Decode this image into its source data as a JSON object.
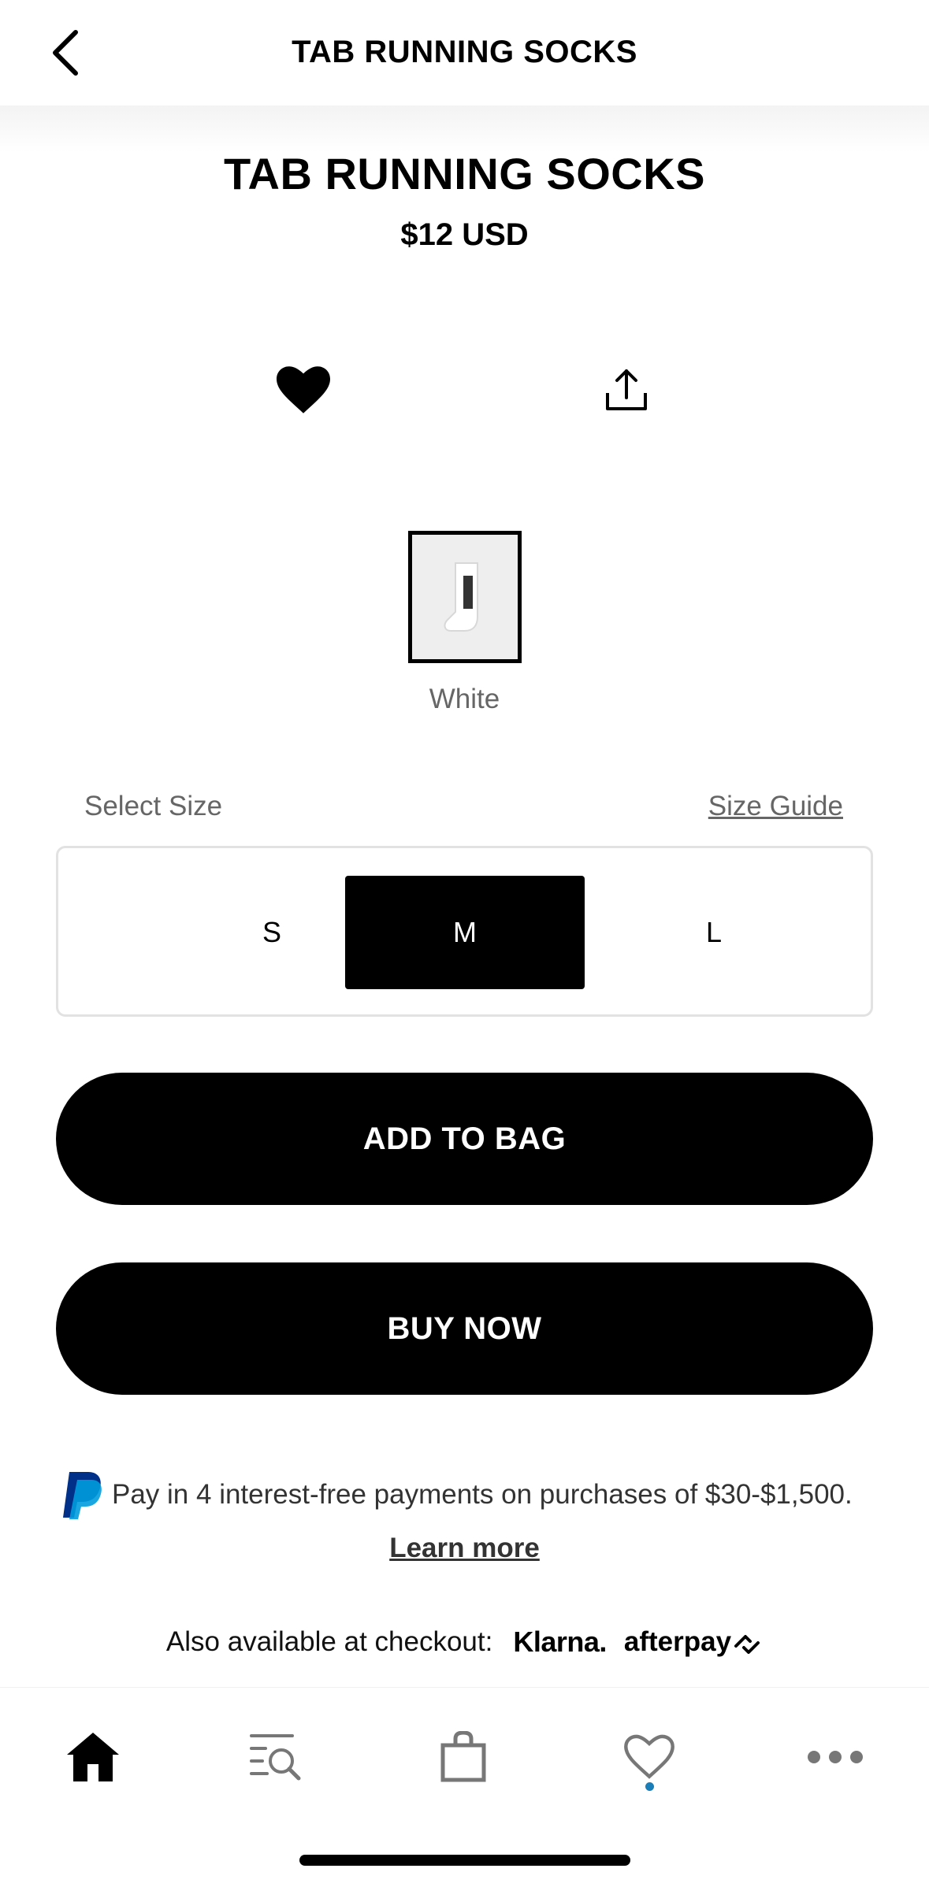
{
  "header": {
    "title": "TAB RUNNING SOCKS"
  },
  "product": {
    "title": "TAB RUNNING SOCKS",
    "price": "$12 USD"
  },
  "color": {
    "selected_label": "White"
  },
  "size": {
    "label": "Select Size",
    "guide_label": "Size Guide",
    "options": [
      "S",
      "M",
      "L"
    ],
    "selected": "M"
  },
  "actions": {
    "add_to_bag": "ADD TO BAG",
    "buy_now": "BUY NOW"
  },
  "paypal": {
    "text": "Pay in 4 interest-free payments on purchases of $30-$1,500.",
    "learn_more": "Learn more"
  },
  "checkout": {
    "also_text": "Also available at checkout:",
    "klarna": "Klarna.",
    "afterpay": "afterpay"
  },
  "colors": {
    "primary": "#000000",
    "muted_text": "#666666",
    "active_dot": "#1a7fb8",
    "paypal_dark": "#003087",
    "paypal_light": "#009cde"
  },
  "icons": {
    "back": "chevron-left-icon",
    "favorite": "heart-filled-icon",
    "share": "share-icon",
    "tabs": [
      "home-icon",
      "search-list-icon",
      "bag-icon",
      "heart-outline-icon",
      "more-dots-icon"
    ]
  }
}
